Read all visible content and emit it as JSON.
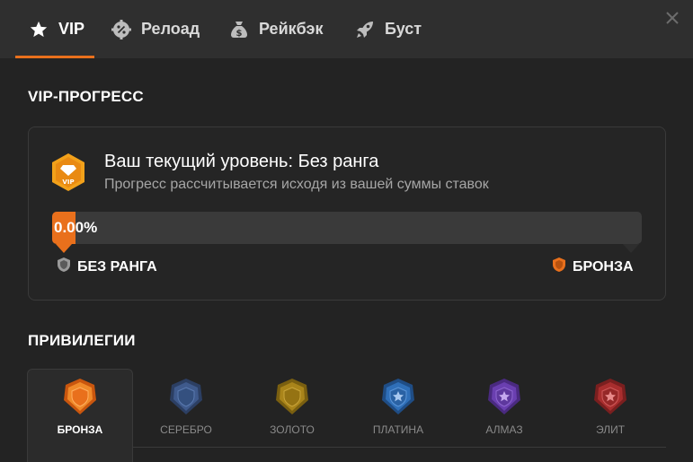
{
  "nav": {
    "tabs": [
      {
        "label": "VIP",
        "icon": "star-icon"
      },
      {
        "label": "Релоад",
        "icon": "percent-gear-icon"
      },
      {
        "label": "Рейкбэк",
        "icon": "money-bag-icon"
      },
      {
        "label": "Буст",
        "icon": "rocket-icon"
      }
    ],
    "active_index": 0,
    "close_icon": "close-icon"
  },
  "progress": {
    "section_title": "VIP-ПРОГРЕСС",
    "level_title": "Ваш текущий уровень: Без ранга",
    "level_subtitle": "Прогресс рассчитывается исходя из вашей суммы ставок",
    "badge_text": "VIP",
    "percent_text": "0.00%",
    "percent_value": 0.0,
    "current_rank": "БЕЗ РАНГА",
    "next_rank": "БРОНЗА"
  },
  "privileges": {
    "section_title": "ПРИВИЛЕГИИ",
    "tiers": [
      {
        "name": "БРОНЗА",
        "color": "#e9701c",
        "emblem": "shield"
      },
      {
        "name": "СЕРЕБРО",
        "color": "#3f5a8c",
        "emblem": "shield"
      },
      {
        "name": "ЗОЛОТО",
        "color": "#a9841a",
        "emblem": "shield"
      },
      {
        "name": "ПЛАТИНА",
        "color": "#2f6fb8",
        "emblem": "star"
      },
      {
        "name": "АЛМАЗ",
        "color": "#6a3fb0",
        "emblem": "star"
      },
      {
        "name": "ЭЛИТ",
        "color": "#a82e2e",
        "emblem": "star"
      }
    ],
    "active_index": 0
  },
  "colors": {
    "accent": "#e9701c",
    "background": "#232323",
    "header": "#2f2f2f",
    "unranked": "#9a9a9a"
  }
}
